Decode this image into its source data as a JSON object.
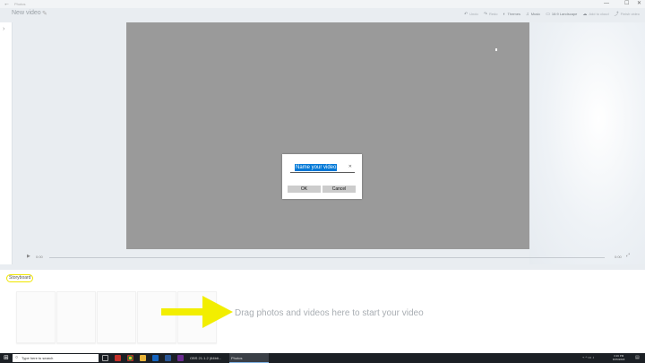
{
  "window": {
    "back_glyph": "←",
    "title": "Photos",
    "controls": {
      "minimize": "—",
      "maximize": "☐",
      "close": "✕"
    }
  },
  "header": {
    "project_title": "New video",
    "toolbar": [
      {
        "id": "undo",
        "label": "Undo",
        "icon": "undo-icon",
        "glyph": "↶"
      },
      {
        "id": "redo",
        "label": "Redo",
        "icon": "redo-icon",
        "glyph": "↷"
      },
      {
        "id": "themes",
        "label": "Themes",
        "icon": "palette-icon",
        "glyph": "◐"
      },
      {
        "id": "music",
        "label": "Music",
        "icon": "music-icon",
        "glyph": "♫"
      },
      {
        "id": "aspect",
        "label": "16:9 Landscape",
        "icon": "aspect-icon",
        "glyph": "▭"
      },
      {
        "id": "cloud",
        "label": "Add to cloud",
        "icon": "cloud-icon",
        "glyph": "☁"
      },
      {
        "id": "finish",
        "label": "Finish video",
        "icon": "export-icon",
        "glyph": "⤴"
      }
    ]
  },
  "dialog": {
    "input_value": "Name your video",
    "clear_glyph": "✕",
    "ok_label": "OK",
    "cancel_label": "Cancel"
  },
  "playback": {
    "play_glyph": "▶",
    "current_time": "0:00",
    "total_time": "0:00",
    "fullscreen_glyph": "⤢"
  },
  "storyboard": {
    "label": "Storyboard",
    "drop_hint": "Drag photos and videos here to start your video",
    "arrow_color": "#f2ee00"
  },
  "taskbar": {
    "start_glyph": "⊞",
    "search_icon": "○",
    "search_placeholder": "Type here to search",
    "apps": [
      {
        "label": "OBS 21.1.2 (64bit...",
        "active": false
      },
      {
        "label": "Photos",
        "active": true
      }
    ],
    "tray_glyphs": "⌁ ^ ▭ ♪",
    "time": "3:16 PM",
    "date": "8/15/2018",
    "notification_glyph": "▤"
  },
  "colors": {
    "accent": "#0078d7",
    "preview_bg": "#9a9a9a",
    "taskbar_bg": "#1b1f24"
  }
}
